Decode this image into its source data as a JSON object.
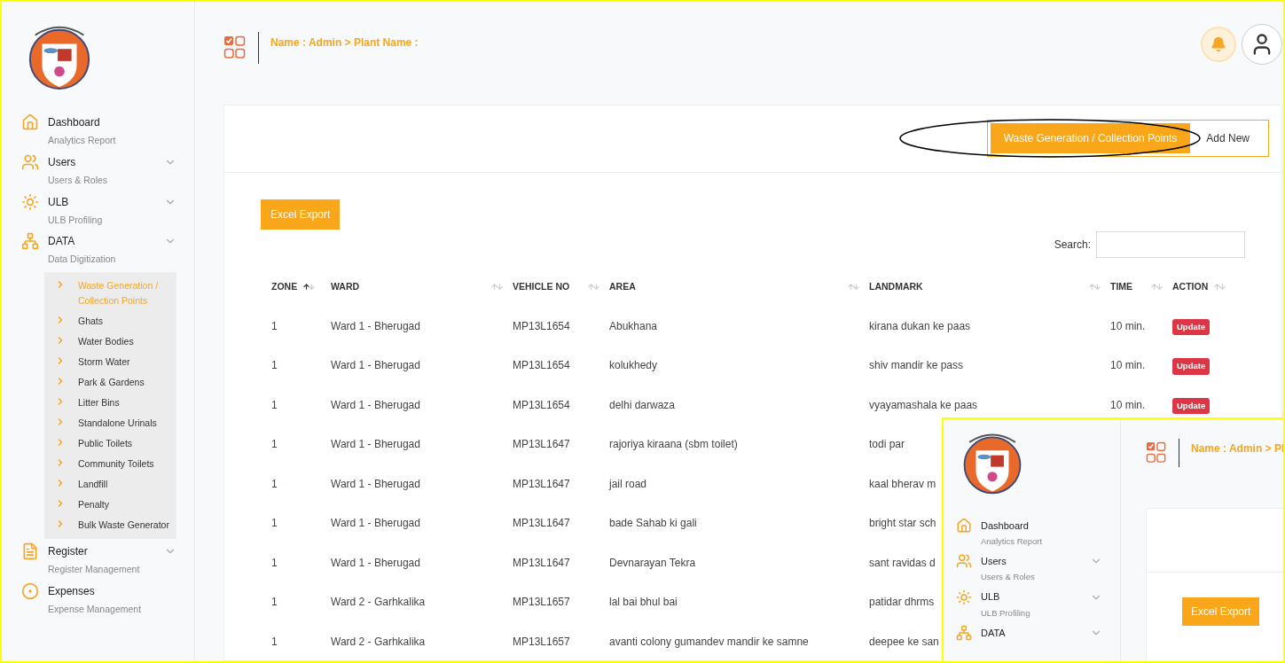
{
  "header": {
    "breadcrumb": "Name : Admin > Plant Name :"
  },
  "sidebar": {
    "items": [
      {
        "title": "Dashboard",
        "subtitle": "Analytics Report",
        "chevron": false
      },
      {
        "title": "Users",
        "subtitle": "Users & Roles",
        "chevron": true
      },
      {
        "title": "ULB",
        "subtitle": "ULB Profiling",
        "chevron": true
      },
      {
        "title": "DATA",
        "subtitle": "Data Digitization",
        "chevron": true,
        "children": [
          {
            "label": "Waste Generation / Collection Points",
            "selected": true
          },
          {
            "label": "Ghats",
            "selected": false
          },
          {
            "label": "Water Bodies",
            "selected": false
          },
          {
            "label": "Storm Water",
            "selected": false
          },
          {
            "label": "Park & Gardens",
            "selected": false
          },
          {
            "label": "Litter Bins",
            "selected": false
          },
          {
            "label": "Standalone Urinals",
            "selected": false
          },
          {
            "label": "Public Toilets",
            "selected": false
          },
          {
            "label": "Community Toilets",
            "selected": false
          },
          {
            "label": "Landfill",
            "selected": false
          },
          {
            "label": "Penalty",
            "selected": false
          },
          {
            "label": "Bulk Waste Generator",
            "selected": false
          }
        ]
      },
      {
        "title": "Register",
        "subtitle": "Register Management",
        "chevron": true
      },
      {
        "title": "Expenses",
        "subtitle": "Expense Management",
        "chevron": false
      }
    ]
  },
  "toggle": [
    {
      "label": "Waste Generation / Collection Points",
      "selected": true
    },
    {
      "label": "Add New",
      "selected": false
    }
  ],
  "export_button": "Excel Export",
  "search": {
    "label": "Search:"
  },
  "table": {
    "columns": [
      {
        "label": "ZONE",
        "sorted": true
      },
      {
        "label": "WARD",
        "sorted": false
      },
      {
        "label": "VEHICLE NO",
        "sorted": false
      },
      {
        "label": "AREA",
        "sorted": false
      },
      {
        "label": "LANDMARK",
        "sorted": false
      },
      {
        "label": "TIME",
        "sorted": false
      },
      {
        "label": "ACTION",
        "sorted": false
      }
    ],
    "rows": [
      {
        "zone": "1",
        "ward": "Ward 1 - Bherugad",
        "vehicle": "MP13L1654",
        "area": "Abukhana",
        "landmark": "kirana dukan ke paas",
        "time": "10 min.",
        "action": "Update"
      },
      {
        "zone": "1",
        "ward": "Ward 1 - Bherugad",
        "vehicle": "MP13L1654",
        "area": "kolukhedy",
        "landmark": "shiv mandir ke pass",
        "time": "10 min.",
        "action": "Update"
      },
      {
        "zone": "1",
        "ward": "Ward 1 - Bherugad",
        "vehicle": "MP13L1654",
        "area": "delhi darwaza",
        "landmark": "vyayamashala ke paas",
        "time": "10 min.",
        "action": "Update"
      },
      {
        "zone": "1",
        "ward": "Ward 1 - Bherugad",
        "vehicle": "MP13L1647",
        "area": "rajoriya kiraana (sbm toilet)",
        "landmark": "todi par"
      },
      {
        "zone": "1",
        "ward": "Ward 1 - Bherugad",
        "vehicle": "MP13L1647",
        "area": "jail road",
        "landmark": "kaal bherav m"
      },
      {
        "zone": "1",
        "ward": "Ward 1 - Bherugad",
        "vehicle": "MP13L1647",
        "area": "bade Sahab ki gali",
        "landmark": "bright star sch"
      },
      {
        "zone": "1",
        "ward": "Ward 1 - Bherugad",
        "vehicle": "MP13L1647",
        "area": "Devnarayan Tekra",
        "landmark": "sant ravidas d"
      },
      {
        "zone": "1",
        "ward": "Ward 2 - Garhkalika",
        "vehicle": "MP13L1657",
        "area": "lal bai bhul bai",
        "landmark": "patidar dhrms"
      },
      {
        "zone": "1",
        "ward": "Ward 2 - Garhkalika",
        "vehicle": "MP13L1657",
        "area": "avanti colony gumandev mandir ke samne",
        "landmark": "deepee ke san"
      }
    ]
  },
  "inset": {
    "breadcrumb": "Name : Admin > Pl",
    "items": [
      {
        "title": "Dashboard",
        "subtitle": "Analytics Report",
        "chevron": false
      },
      {
        "title": "Users",
        "subtitle": "Users & Roles",
        "chevron": true
      },
      {
        "title": "ULB",
        "subtitle": "ULB Profiling",
        "chevron": true
      },
      {
        "title": "DATA",
        "chevron": true
      }
    ],
    "export_button": "Excel Export"
  }
}
